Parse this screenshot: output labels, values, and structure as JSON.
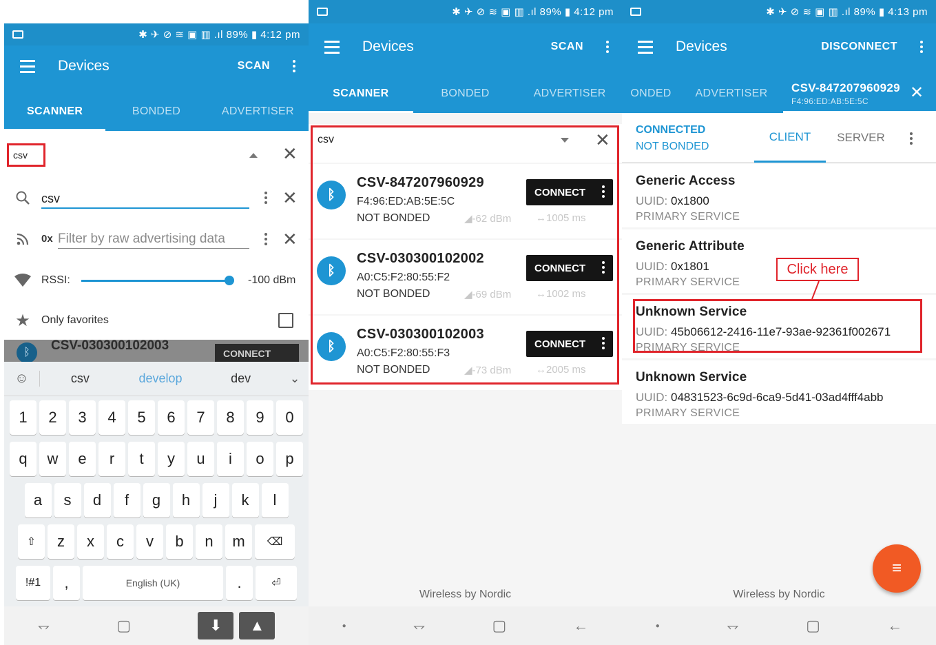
{
  "statusbar": {
    "p1_text": "✱ ✈ ⊘ ≋ ▣ ▥ .ıl 89% ▮ 4:12 pm",
    "p2_text": "✱ ✈ ⊘ ≋ ▣ ▥ .ıl 89% ▮ 4:12 pm",
    "p3_text": "✱ ✈ ⊘ ≋ ▣ ▥ .ıl 89% ▮ 4:13 pm"
  },
  "appbar": {
    "title": "Devices",
    "scan": "SCAN",
    "disconnect": "DISCONNECT"
  },
  "tabs": {
    "scanner": "SCANNER",
    "bonded": "BONDED",
    "advertiser": "ADVERTISER",
    "bonded_cut": "ONDED"
  },
  "filter": {
    "chip": "csv",
    "name_value": "csv",
    "raw_prefix": "0x",
    "raw_placeholder": "Filter by raw advertising data",
    "rssi_label": "RSSI:",
    "rssi_value": "-100 dBm",
    "favorites_label": "Only favorites"
  },
  "keyboard": {
    "suggestions": [
      "csv",
      "develop",
      "dev"
    ],
    "row1": [
      "1",
      "2",
      "3",
      "4",
      "5",
      "6",
      "7",
      "8",
      "9",
      "0"
    ],
    "row2": [
      "q",
      "w",
      "e",
      "r",
      "t",
      "y",
      "u",
      "i",
      "o",
      "p"
    ],
    "row3": [
      "a",
      "s",
      "d",
      "f",
      "g",
      "h",
      "j",
      "k",
      "l"
    ],
    "row4": [
      "z",
      "x",
      "c",
      "v",
      "b",
      "n",
      "m"
    ],
    "symbols": "!#1",
    "comma": ",",
    "space": "English (UK)",
    "period": "."
  },
  "devices": [
    {
      "name": "CSV-847207960929",
      "mac": "F4:96:ED:AB:5E:5C",
      "bond": "NOT BONDED",
      "rssi": "-62 dBm",
      "interval": "1005 ms",
      "connect": "CONNECT"
    },
    {
      "name": "CSV-030300102002",
      "mac": "A0:C5:F2:80:55:F2",
      "bond": "NOT BONDED",
      "rssi": "-69 dBm",
      "interval": "1002 ms",
      "connect": "CONNECT"
    },
    {
      "name": "CSV-030300102003",
      "mac": "A0:C5:F2:80:55:F3",
      "bond": "NOT BONDED",
      "rssi": "-73 dBm",
      "interval": "2005 ms",
      "connect": "CONNECT"
    }
  ],
  "peek_device": {
    "name": "CSV-030300102003",
    "connect": "CONNECT"
  },
  "search": {
    "value": "csv"
  },
  "footer": "Wireless by Nordic",
  "connection": {
    "device_name": "CSV-847207960929",
    "device_mac": "F4:96:ED:AB:5E:5C",
    "status": "CONNECTED",
    "bond": "NOT BONDED",
    "client": "CLIENT",
    "server": "SERVER"
  },
  "services": [
    {
      "name": "Generic Access",
      "uuid_label": "UUID:",
      "uuid": "0x1800",
      "type": "PRIMARY SERVICE"
    },
    {
      "name": "Generic Attribute",
      "uuid_label": "UUID:",
      "uuid": "0x1801",
      "type": "PRIMARY SERVICE"
    },
    {
      "name": "Unknown Service",
      "uuid_label": "UUID:",
      "uuid": "45b06612-2416-11e7-93ae-92361f002671",
      "type": "PRIMARY SERVICE"
    },
    {
      "name": "Unknown Service",
      "uuid_label": "UUID:",
      "uuid": "04831523-6c9d-6ca9-5d41-03ad4fff4abb",
      "type": "PRIMARY SERVICE"
    }
  ],
  "annotation": {
    "callout": "Click here"
  },
  "colors": {
    "primary": "#1e95d3",
    "highlight": "#e0242b",
    "fab": "#f15a24"
  }
}
